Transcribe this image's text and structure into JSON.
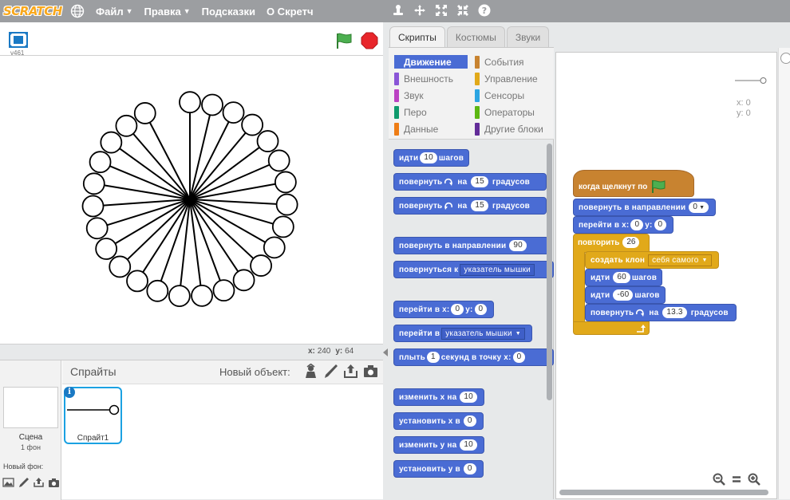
{
  "menubar": {
    "logo": "SCRATCH",
    "items": [
      {
        "label": "Файл",
        "has_caret": true
      },
      {
        "label": "Правка",
        "has_caret": true
      },
      {
        "label": "Подсказки",
        "has_caret": false
      },
      {
        "label": "О Скретч",
        "has_caret": false
      }
    ],
    "tools": [
      "duplicate-icon",
      "cut-icon",
      "grow-icon",
      "shrink-icon",
      "help-icon"
    ]
  },
  "stage": {
    "version": "v461",
    "mouse_x_label": "x:",
    "mouse_x": "240",
    "mouse_y_label": "y:",
    "mouse_y": "64",
    "drawing": {
      "clone_count": 26,
      "step": 60,
      "turn_degrees": 13.3
    }
  },
  "sprite_pane": {
    "stage_label": "Сцена",
    "backdrop_count": "1 фон",
    "new_backdrop_label": "Новый фон:",
    "sprites_title": "Спрайты",
    "new_sprite_label": "Новый объект:",
    "sprites": [
      {
        "name": "Спрайт1"
      }
    ]
  },
  "tabs": [
    {
      "label": "Скрипты",
      "active": true
    },
    {
      "label": "Костюмы",
      "active": false
    },
    {
      "label": "Звуки",
      "active": false
    }
  ],
  "categories": [
    {
      "label": "Движение",
      "color": "#4a6cd4",
      "active": true
    },
    {
      "label": "Внешность",
      "color": "#8a55d7",
      "active": false
    },
    {
      "label": "Звук",
      "color": "#bb42c3",
      "active": false
    },
    {
      "label": "Перо",
      "color": "#0e9a6c",
      "active": false
    },
    {
      "label": "Данные",
      "color": "#ee7d16",
      "active": false
    },
    {
      "label": "События",
      "color": "#c88330",
      "active": false
    },
    {
      "label": "Управление",
      "color": "#e1a91a",
      "active": false
    },
    {
      "label": "Сенсоры",
      "color": "#2ca5e2",
      "active": false
    },
    {
      "label": "Операторы",
      "color": "#5cb712",
      "active": false
    },
    {
      "label": "Другие блоки",
      "color": "#632d99",
      "active": false
    }
  ],
  "palette_blocks": {
    "move": {
      "a": "идти",
      "n": "10",
      "b": "шагов"
    },
    "turn_right": {
      "a": "повернуть",
      "b": "на",
      "n": "15",
      "c": "градусов"
    },
    "turn_left": {
      "a": "повернуть",
      "b": "на",
      "n": "15",
      "c": "градусов"
    },
    "point_dir": {
      "a": "повернуть в направлении",
      "n": "90"
    },
    "point_towards": {
      "a": "повернуться к",
      "d": "указатель мышки"
    },
    "goto_xy": {
      "a": "перейти в x:",
      "x": "0",
      "b": "y:",
      "y": "0"
    },
    "goto": {
      "a": "перейти в",
      "d": "указатель мышки"
    },
    "glide": {
      "a": "плыть",
      "n": "1",
      "b": "секунд в точку x:",
      "x": "0"
    },
    "change_x": {
      "a": "изменить х на",
      "n": "10"
    },
    "set_x": {
      "a": "установить х в",
      "n": "0"
    },
    "change_y": {
      "a": "изменить у на",
      "n": "10"
    },
    "set_y": {
      "a": "установить у в",
      "n": "0"
    }
  },
  "script": {
    "hat": "когда щелкнут по",
    "point_dir": {
      "a": "повернуть в направлении",
      "n": "0"
    },
    "goto_xy": {
      "a": "перейти в x:",
      "x": "0",
      "b": "y:",
      "y": "0"
    },
    "repeat": {
      "a": "повторить",
      "n": "26"
    },
    "clone": {
      "a": "создать клон",
      "d": "себя самого"
    },
    "move1": {
      "a": "идти",
      "n": "60",
      "b": "шагов"
    },
    "move2": {
      "a": "идти",
      "n": "-60",
      "b": "шагов"
    },
    "turn": {
      "a": "повернуть",
      "b": "на",
      "n": "13.3",
      "c": "градусов"
    }
  },
  "sprite_info": {
    "x_label": "x:",
    "x": "0",
    "y_label": "y:",
    "y": "0"
  }
}
